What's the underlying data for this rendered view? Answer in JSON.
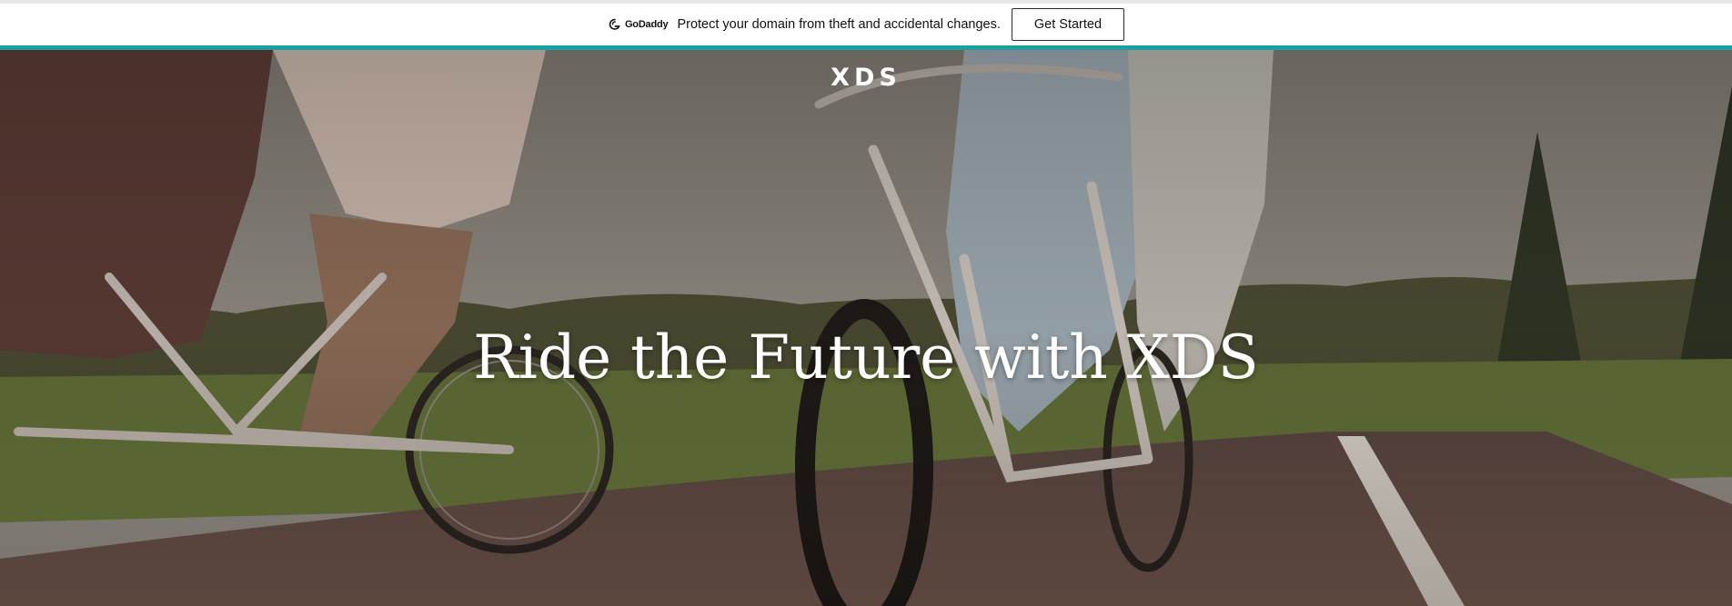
{
  "banner": {
    "brand_name": "GoDaddy",
    "brand_icon": "godaddy-logo-icon",
    "message": "Protect your domain from theft and accidental changes.",
    "cta_label": "Get Started"
  },
  "hero": {
    "site_logo": "XDS",
    "headline": "Ride the Future with XDS",
    "background_image": "people riding bicycles on a park road"
  },
  "colors": {
    "accent": "#1b9f9f",
    "banner_bg": "#ffffff",
    "text_on_hero": "#ffffff"
  }
}
